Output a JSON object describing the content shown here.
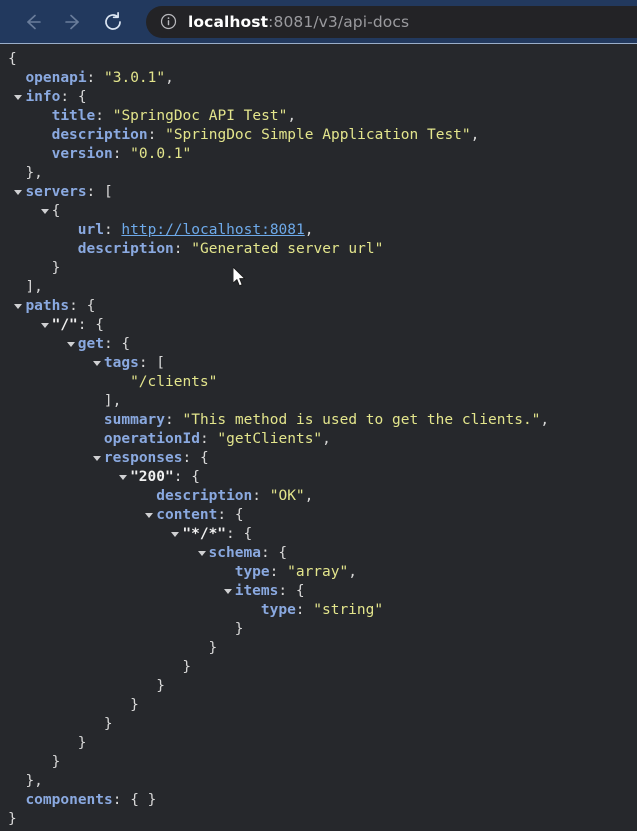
{
  "browser": {
    "back_label": "Back",
    "forward_label": "Forward",
    "reload_label": "Reload",
    "site_info_label": "View site information",
    "url_host": "localhost",
    "url_rest": ":8081/v3/api-docs",
    "toolbar_bg": "#22395e",
    "omnibox_bg": "#232326"
  },
  "viewer": {
    "background": "#26282c",
    "key_color": "#8aa9e0",
    "string_color": "#e3e58c",
    "punctuation_color": "#d8d8d8",
    "link_color": "#6eaaea",
    "lines": [
      {
        "id": 0,
        "indent": 0,
        "triangle": false,
        "text": "{"
      },
      {
        "id": 1,
        "indent": 2,
        "triangle": false,
        "key": "openapi",
        "value": "\"3.0.1\"",
        "text": "openapi: \"3.0.1\","
      },
      {
        "id": 2,
        "indent": 2,
        "triangle": true,
        "key": "info",
        "text": "info: {"
      },
      {
        "id": 3,
        "indent": 5,
        "triangle": false,
        "key": "title",
        "value": "\"SpringDoc API Test\"",
        "text": "title: \"SpringDoc API Test\","
      },
      {
        "id": 4,
        "indent": 5,
        "triangle": false,
        "key": "description",
        "value": "\"SpringDoc Simple Application Test\"",
        "text": "description: \"SpringDoc Simple Application Test\","
      },
      {
        "id": 5,
        "indent": 5,
        "triangle": false,
        "key": "version",
        "value": "\"0.0.1\"",
        "text": "version: \"0.0.1\""
      },
      {
        "id": 6,
        "indent": 2,
        "triangle": false,
        "text": "},"
      },
      {
        "id": 7,
        "indent": 2,
        "triangle": true,
        "key": "servers",
        "text": "servers: ["
      },
      {
        "id": 8,
        "indent": 5,
        "triangle": true,
        "text": "{"
      },
      {
        "id": 9,
        "indent": 8,
        "triangle": false,
        "key": "url",
        "value": "http://localhost:8081",
        "text": "url: http://localhost:8081,"
      },
      {
        "id": 10,
        "indent": 8,
        "triangle": false,
        "key": "description",
        "value": "\"Generated server url\"",
        "text": "description: \"Generated server url\""
      },
      {
        "id": 11,
        "indent": 5,
        "triangle": false,
        "text": "}"
      },
      {
        "id": 12,
        "indent": 2,
        "triangle": false,
        "text": "],"
      },
      {
        "id": 13,
        "indent": 2,
        "triangle": true,
        "key": "paths",
        "text": "paths: {"
      },
      {
        "id": 14,
        "indent": 5,
        "triangle": true,
        "key": "\"/\"",
        "text": "\"/\": {"
      },
      {
        "id": 15,
        "indent": 8,
        "triangle": true,
        "key": "get",
        "text": "get: {"
      },
      {
        "id": 16,
        "indent": 11,
        "triangle": true,
        "key": "tags",
        "text": "tags: ["
      },
      {
        "id": 17,
        "indent": 14,
        "triangle": false,
        "value": "\"/clients\"",
        "text": "\"/clients\""
      },
      {
        "id": 18,
        "indent": 11,
        "triangle": false,
        "text": "],"
      },
      {
        "id": 19,
        "indent": 11,
        "triangle": false,
        "key": "summary",
        "value": "\"This method is used to get the clients.\"",
        "text": "summary: \"This method is used to get the clients.\","
      },
      {
        "id": 20,
        "indent": 11,
        "triangle": false,
        "key": "operationId",
        "value": "\"getClients\"",
        "text": "operationId: \"getClients\","
      },
      {
        "id": 21,
        "indent": 11,
        "triangle": true,
        "key": "responses",
        "text": "responses: {"
      },
      {
        "id": 22,
        "indent": 14,
        "triangle": true,
        "key": "\"200\"",
        "text": "\"200\": {"
      },
      {
        "id": 23,
        "indent": 17,
        "triangle": false,
        "key": "description",
        "value": "\"OK\"",
        "text": "description: \"OK\","
      },
      {
        "id": 24,
        "indent": 17,
        "triangle": true,
        "key": "content",
        "text": "content: {"
      },
      {
        "id": 25,
        "indent": 20,
        "triangle": true,
        "key": "\"*/*\"",
        "text": "\"*/*\": {"
      },
      {
        "id": 26,
        "indent": 23,
        "triangle": true,
        "key": "schema",
        "text": "schema: {"
      },
      {
        "id": 27,
        "indent": 26,
        "triangle": false,
        "key": "type",
        "value": "\"array\"",
        "text": "type: \"array\","
      },
      {
        "id": 28,
        "indent": 26,
        "triangle": true,
        "key": "items",
        "text": "items: {"
      },
      {
        "id": 29,
        "indent": 29,
        "triangle": false,
        "key": "type",
        "value": "\"string\"",
        "text": "type: \"string\""
      },
      {
        "id": 30,
        "indent": 26,
        "triangle": false,
        "text": "}"
      },
      {
        "id": 31,
        "indent": 23,
        "triangle": false,
        "text": "}"
      },
      {
        "id": 32,
        "indent": 20,
        "triangle": false,
        "text": "}"
      },
      {
        "id": 33,
        "indent": 17,
        "triangle": false,
        "text": "}"
      },
      {
        "id": 34,
        "indent": 14,
        "triangle": false,
        "text": "}"
      },
      {
        "id": 35,
        "indent": 11,
        "triangle": false,
        "text": "}"
      },
      {
        "id": 36,
        "indent": 8,
        "triangle": false,
        "text": "}"
      },
      {
        "id": 37,
        "indent": 5,
        "triangle": false,
        "text": "}"
      },
      {
        "id": 38,
        "indent": 2,
        "triangle": false,
        "text": "},"
      },
      {
        "id": 39,
        "indent": 2,
        "triangle": false,
        "key": "components",
        "value": "{ }",
        "text": "components: { }"
      },
      {
        "id": 40,
        "indent": 0,
        "triangle": false,
        "text": "}"
      }
    ]
  }
}
